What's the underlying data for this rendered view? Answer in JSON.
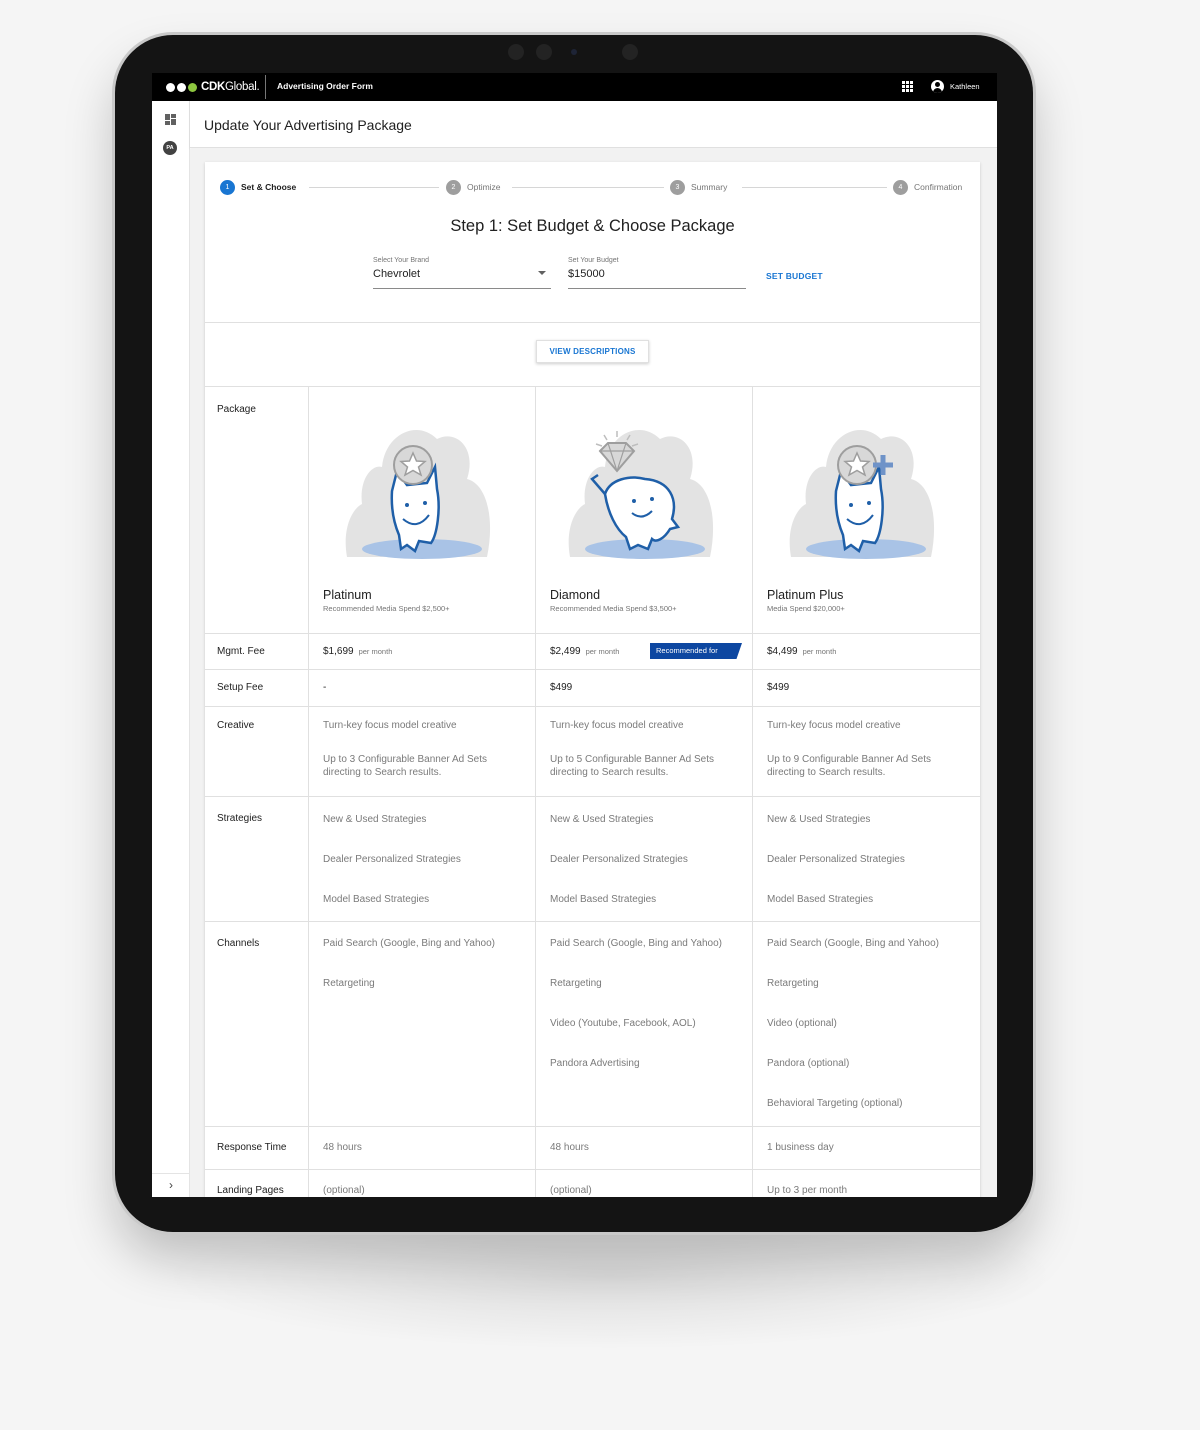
{
  "topbar": {
    "logo_text_bold": "CDK",
    "logo_text": "Global.",
    "app_title": "Advertising Order Form",
    "apps_icon": "apps-grid-icon",
    "user_icon": "account-circle-icon",
    "username": "Kathleen"
  },
  "sidenav": {
    "dashboard_icon": "dashboard-icon",
    "avatar_initials": "PA",
    "expand_label": "›"
  },
  "page": {
    "title": "Update Your Advertising Package"
  },
  "stepper": {
    "steps": [
      {
        "num": "1",
        "label": "Set & Choose",
        "active": true
      },
      {
        "num": "2",
        "label": "Optimize",
        "active": false
      },
      {
        "num": "3",
        "label": "Summary",
        "active": false
      },
      {
        "num": "4",
        "label": "Confirmation",
        "active": false
      }
    ]
  },
  "step_heading": "Step 1: Set Budget & Choose Package",
  "form": {
    "brand": {
      "label": "Select Your Brand",
      "value": "Chevrolet"
    },
    "budget": {
      "label": "Set Your Budget",
      "value": "$15000"
    },
    "set_budget_label": "SET BUDGET"
  },
  "view_descriptions_label": "VIEW DESCRIPTIONS",
  "table": {
    "row_labels": {
      "package": "Package",
      "mgmt_fee": "Mgmt. Fee",
      "setup_fee": "Setup Fee",
      "creative": "Creative",
      "strategies": "Strategies",
      "channels": "Channels",
      "response_time": "Response Time",
      "landing_pages": "Landing Pages"
    },
    "per_month_label": "per month",
    "recommended_label": "Recommended for",
    "packages": [
      {
        "name": "Platinum",
        "subtitle": "Recommended Media Spend $2,500+",
        "mgmt_fee": "$1,699",
        "setup_fee": "-",
        "creative": [
          "Turn-key focus model creative",
          "Up to 3 Configurable Banner Ad Sets",
          "directing to Search results."
        ],
        "strategies": [
          "New & Used Strategies",
          "Dealer Personalized Strategies",
          "Model Based Strategies"
        ],
        "channels": [
          "Paid Search (Google, Bing and Yahoo)",
          "Retargeting"
        ],
        "response_time": "48 hours",
        "landing_pages": "(optional)"
      },
      {
        "name": "Diamond",
        "subtitle": "Recommended Media Spend $3,500+",
        "mgmt_fee": "$2,499",
        "setup_fee": "$499",
        "creative": [
          "Turn-key focus model creative",
          "Up to 5 Configurable Banner Ad Sets",
          "directing to Search results."
        ],
        "strategies": [
          "New & Used Strategies",
          "Dealer Personalized Strategies",
          "Model Based Strategies"
        ],
        "channels": [
          "Paid Search (Google, Bing and Yahoo)",
          "Retargeting",
          "Video (Youtube, Facebook, AOL)",
          "Pandora Advertising"
        ],
        "response_time": "48 hours",
        "landing_pages": "(optional)"
      },
      {
        "name": "Platinum Plus",
        "subtitle": "Media Spend $20,000+",
        "mgmt_fee": "$4,499",
        "setup_fee": "$499",
        "creative": [
          "Turn-key focus model creative",
          "Up to 9 Configurable Banner Ad Sets",
          "directing to Search results."
        ],
        "strategies": [
          "New & Used Strategies",
          "Dealer Personalized Strategies",
          "Model Based Strategies"
        ],
        "channels": [
          "Paid Search (Google, Bing and Yahoo)",
          "Retargeting",
          "Video (optional)",
          "Pandora (optional)",
          "Behavioral Targeting (optional)"
        ],
        "response_time": "1 business day",
        "landing_pages": "Up to 3 per month"
      }
    ]
  },
  "colors": {
    "accent": "#1976d2",
    "badge": "#0d47a1",
    "logo_green": "#8dc63f",
    "mascot_blue": "#1f5fa8"
  }
}
